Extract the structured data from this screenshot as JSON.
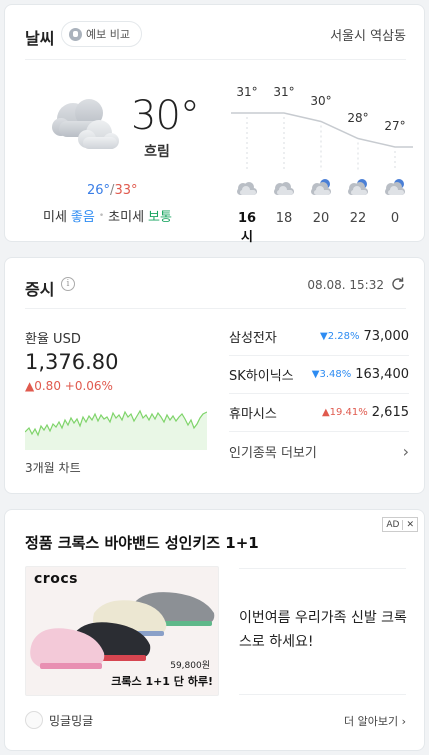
{
  "weather": {
    "title": "날씨",
    "compare_label": "예보 비교",
    "location": "서울시 역삼동",
    "current_temp": "30°",
    "condition": "흐림",
    "low": "26°",
    "high": "33°",
    "range_sep": "/",
    "dust_label": "미세",
    "dust_value": "좋음",
    "fine_dust_label": "초미세",
    "fine_dust_value": "보통",
    "hourly": [
      {
        "time": "16시",
        "temp": "31°",
        "icon": "cloudy-icon"
      },
      {
        "time": "18",
        "temp": "31°",
        "icon": "cloudy-icon"
      },
      {
        "time": "20",
        "temp": "30°",
        "icon": "night-cloudy-icon"
      },
      {
        "time": "22",
        "temp": "28°",
        "icon": "night-cloudy-icon"
      },
      {
        "time": "0",
        "temp": "27°",
        "icon": "night-cloudy-icon"
      }
    ]
  },
  "stock": {
    "title": "증시",
    "time": "08.08. 15:32",
    "fx": {
      "label": "환율 USD",
      "value": "1,376.80",
      "change": "▲0.80  +0.06%",
      "period": "3개월 차트"
    },
    "list": [
      {
        "name": "삼성전자",
        "rate": "▼2.28%",
        "dir": "down",
        "price": "73,000"
      },
      {
        "name": "SK하이닉스",
        "rate": "▼3.48%",
        "dir": "down",
        "price": "163,400"
      },
      {
        "name": "휴마시스",
        "rate": "▲19.41%",
        "dir": "up",
        "price": "2,615"
      }
    ],
    "more_label": "인기종목 더보기",
    "colors": {
      "up": "#e05a4e",
      "down": "#2e8cf2",
      "chart_fill": "#e9f7e6",
      "chart_line": "#7fd46a"
    }
  },
  "ad": {
    "badge": "AD",
    "close": "✕",
    "title": "정품 크록스 바야밴드 성인키즈 1+1",
    "image_brand": "crocs",
    "image_price": "59,800원",
    "image_promo": "크록스 1+1 단 하루!",
    "description": "이번여름 우리가족 신발 크록스로 하세요!",
    "advertiser": "밍글밍글",
    "more_label": "더 알아보기"
  }
}
